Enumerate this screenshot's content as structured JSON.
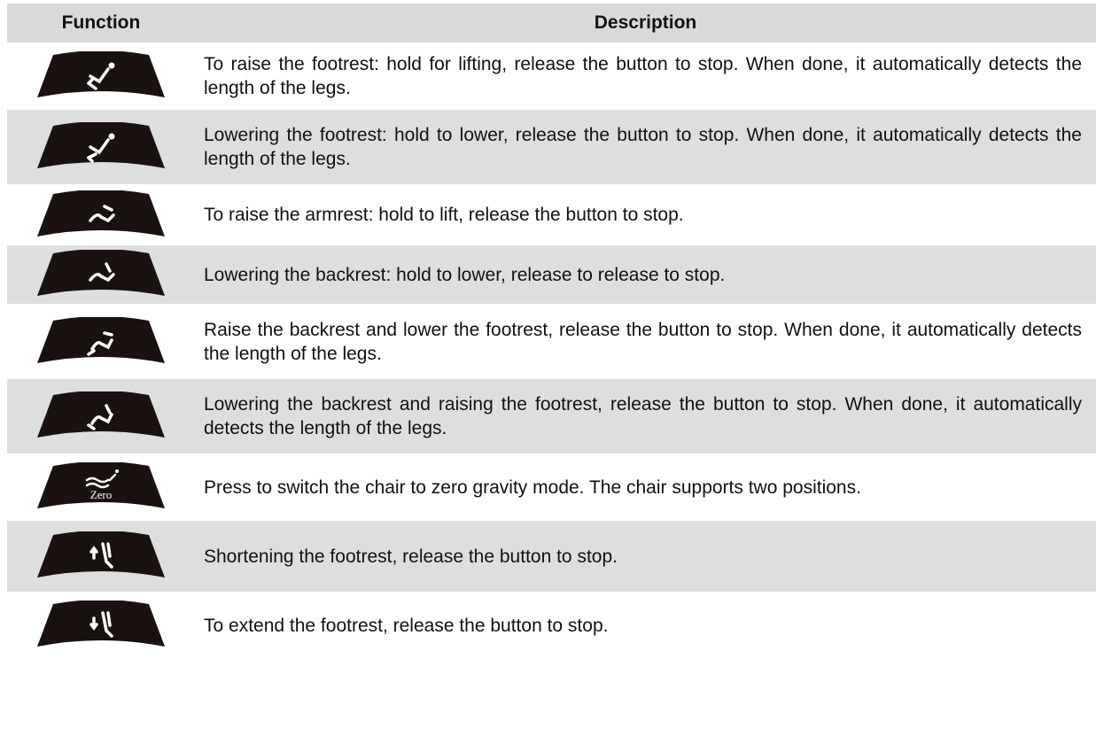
{
  "header": {
    "function": "Function",
    "description": "Description"
  },
  "rows": [
    {
      "icon": "footrest-raise-icon",
      "text": "To raise the footrest: hold for lifting, release the button to stop. When done, it automatically detects the length of the legs."
    },
    {
      "icon": "footrest-lower-icon",
      "text": "Lowering the footrest: hold to lower, release the button to stop. When done, it automatically detects the length of the legs."
    },
    {
      "icon": "backrest-raise-icon",
      "text": "To raise the armrest: hold to lift, release the button to stop."
    },
    {
      "icon": "backrest-lower-icon",
      "text": "Lowering the backrest: hold to lower, release to release to stop."
    },
    {
      "icon": "backrest-up-footrest-down-icon",
      "text": "Raise the backrest and lower the footrest, release the button to stop. When done, it automatically detects the length of the legs."
    },
    {
      "icon": "backrest-down-footrest-up-icon",
      "text": "Lowering the backrest and raising the footrest, release the button to stop. When done, it automatically detects the length of the legs."
    },
    {
      "icon": "zero-gravity-icon",
      "text": "Press to switch the chair to zero gravity mode. The chair supports two positions.",
      "icon_label": "Zero"
    },
    {
      "icon": "footrest-shorten-icon",
      "text": "Shortening the footrest, release the button to stop."
    },
    {
      "icon": "footrest-extend-icon",
      "text": "To extend the footrest, release the button to stop."
    }
  ],
  "colors": {
    "header_bg": "#d9d9d9",
    "row_gray": "#dedede",
    "button": "#1a1210"
  }
}
